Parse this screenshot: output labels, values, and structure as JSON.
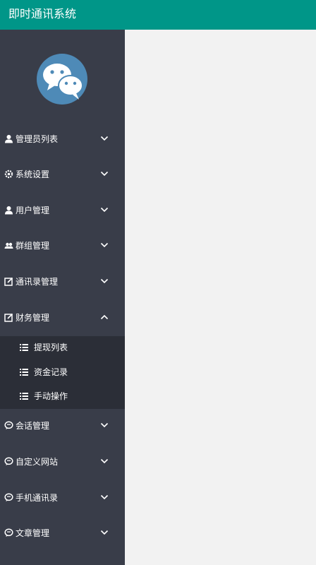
{
  "header": {
    "title": "即时通讯系统"
  },
  "sidebar": {
    "logo_icon": "wechat-logo-icon",
    "menu_items": [
      {
        "label": "管理员列表",
        "icon": "user-icon",
        "chevron": "chevron-down-icon"
      },
      {
        "label": "系统设置",
        "icon": "gear-icon",
        "chevron": "chevron-down-icon"
      },
      {
        "label": "用户管理",
        "icon": "user-icon",
        "chevron": "chevron-down-icon"
      },
      {
        "label": "群组管理",
        "icon": "users-icon",
        "chevron": "chevron-down-icon"
      },
      {
        "label": "通讯录管理",
        "icon": "edit-icon",
        "chevron": "chevron-down-icon"
      },
      {
        "label": "财务管理",
        "icon": "edit-icon",
        "chevron": "chevron-up-icon",
        "expanded": true,
        "submenu": [
          {
            "label": "提现列表",
            "icon": "list-icon"
          },
          {
            "label": "资金记录",
            "icon": "list-icon"
          },
          {
            "label": "手动操作",
            "icon": "list-icon"
          }
        ]
      },
      {
        "label": "会话管理",
        "icon": "chat-icon",
        "chevron": "chevron-down-icon"
      },
      {
        "label": "自定义网站",
        "icon": "chat-icon",
        "chevron": "chevron-down-icon"
      },
      {
        "label": "手机通讯录",
        "icon": "chat-icon",
        "chevron": "chevron-down-icon"
      },
      {
        "label": "文章管理",
        "icon": "chat-icon",
        "chevron": "chevron-down-icon"
      }
    ]
  },
  "colors": {
    "header_bg": "#009688",
    "sidebar_bg": "#393d49",
    "submenu_bg": "#2b2e37",
    "content_bg": "#f2f2f2",
    "logo_bg": "#4e8ab7"
  }
}
